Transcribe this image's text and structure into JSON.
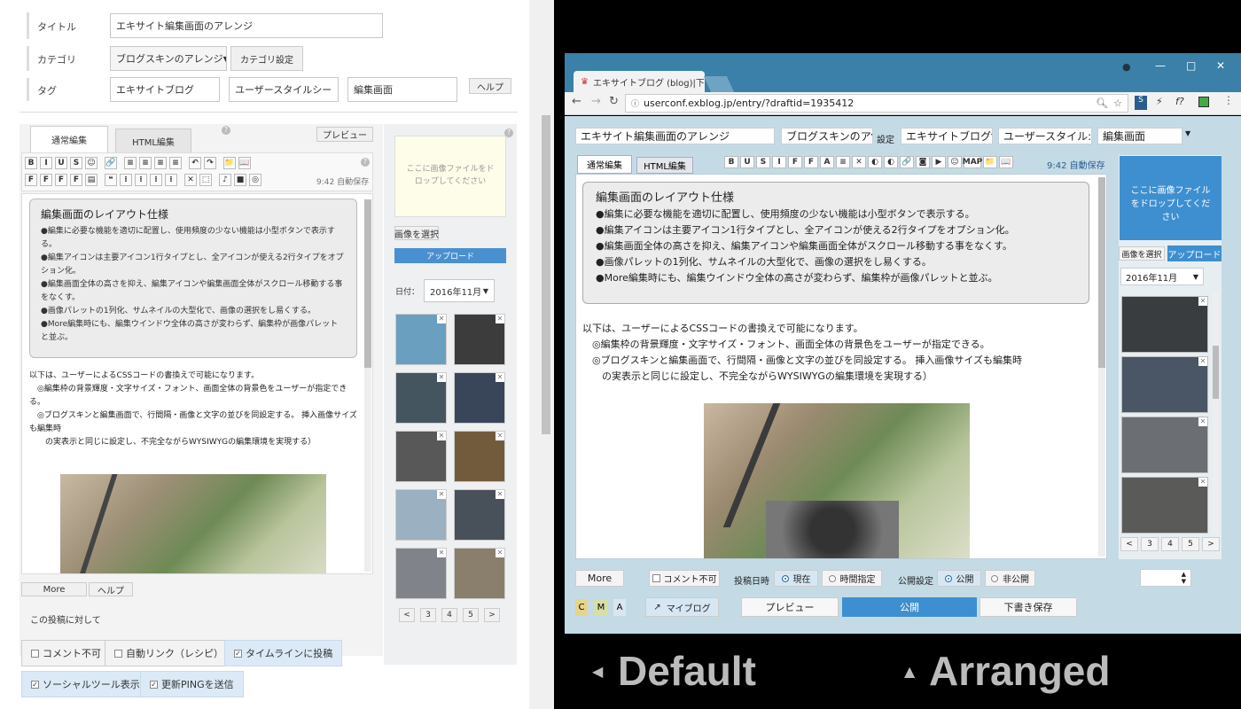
{
  "default_editor": {
    "fields": {
      "title_label": "タイトル",
      "title_value": "エキサイト編集画面のアレンジ",
      "category_label": "カテゴリ",
      "category_value": "ブログスキンのアレンジ",
      "category_settings_button": "カテゴリ設定",
      "tag_label": "タグ",
      "tags": [
        "エキサイトブログ",
        "ユーザースタイルシー",
        "編集画面"
      ],
      "help_button": "ヘルプ"
    },
    "tabs": [
      "通常編集",
      "HTML編集"
    ],
    "preview_button": "プレビュー",
    "toolbar_row1": [
      "B",
      "I",
      "U",
      "S",
      "☺",
      "🔗",
      "≡",
      "≡",
      "≡",
      "≡",
      "↶",
      "↷",
      "📁",
      "📖"
    ],
    "toolbar_row2": [
      "F",
      "F",
      "F",
      "F",
      "▤",
      "❝",
      "⁝",
      "⁝",
      "⁝",
      "⁝",
      "✕",
      "⬚",
      "♪",
      "■",
      "◎"
    ],
    "autosave": "9:42 自動保存",
    "blockquote": {
      "heading": "編集画面のレイアウト仕様",
      "lines": [
        "●編集に必要な機能を適切に配置し、使用頻度の少ない機能は小型ボタンで表示する。",
        "●編集アイコンは主要アイコン1行タイプとし、全アイコンが使える2行タイプをオプション化。",
        "●編集画面全体の高さを抑え、編集アイコンや編集画面全体がスクロール移動する事をなくす。",
        "●画像パレットの1列化、サムネイルの大型化で、画像の選択をし易くする。",
        "●More編集時にも、編集ウインドウ全体の高さが変わらず、編集枠が画像パレットと並ぶ。"
      ]
    },
    "body_lines": [
      "以下は、ユーザーによるCSSコードの書換えで可能になります。",
      "　◎編集枠の背景輝度・文字サイズ・フォント、画面全体の背景色をユーザーが指定できる。",
      "　◎ブログスキンと編集画面で、行間隔・画像と文字の並びを同設定する。 挿入画像サイズも編集時",
      "　　の実表示と同じに設定し、不完全ながらWYSIWYGの編集環境を実現する）"
    ],
    "image_panel": {
      "drop_text": "ここに画像ファイルをドロップしてください",
      "select_button": "画像を選択",
      "upload_button": "アップロード",
      "date_label": "日付：",
      "date_value": "2016年11月",
      "pages": [
        "<",
        "3",
        "4",
        "5",
        ">"
      ]
    },
    "more_button": "More",
    "help_button2": "ヘルプ",
    "post_options_title": "この投稿に対して",
    "checkboxes": [
      {
        "label": "コメント不可",
        "checked": false
      },
      {
        "label": "自動リンク（レシピ）",
        "checked": false
      },
      {
        "label": "タイムラインに投稿",
        "checked": true
      },
      {
        "label": "ソーシャルツール表示",
        "checked": true
      },
      {
        "label": "更新PINGを送信",
        "checked": true
      }
    ]
  },
  "arranged_editor": {
    "browser": {
      "tab_title": "エキサイトブログ (blog)|下書",
      "url": "userconf.exblog.jp/entry/?draftid=1935412"
    },
    "title_value": "エキサイト編集画面のアレンジ",
    "category_value": "ブログスキンのア",
    "settings_label": "設定",
    "tags": [
      "エキサイトブログ",
      "ユーザースタイル:",
      "編集画面"
    ],
    "tabs": [
      "通常編集",
      "HTML編集"
    ],
    "toolbar": [
      "B",
      "U",
      "S",
      "I",
      "F",
      "F",
      "A",
      "≡",
      "✕",
      "◐",
      "◐",
      "🔗",
      "◙",
      "▶",
      "☺",
      "MAP",
      "📁",
      "📖"
    ],
    "autosave": "9:42 自動保存",
    "blockquote": {
      "heading": "編集画面のレイアウト仕様",
      "lines": [
        "●編集に必要な機能を適切に配置し、使用頻度の少ない機能は小型ボタンで表示する。",
        "●編集アイコンは主要アイコン1行タイプとし、全アイコンが使える2行タイプをオプション化。",
        "●編集画面全体の高さを抑え、編集アイコンや編集画面全体がスクロール移動する事をなくす。",
        "●画像パレットの1列化、サムネイルの大型化で、画像の選択をし易くする。",
        "●More編集時にも、編集ウインドウ全体の高さが変わらず、編集枠が画像パレットと並ぶ。"
      ]
    },
    "body_lines": [
      "以下は、ユーザーによるCSSコードの書換えで可能になります。",
      "　◎編集枠の背景輝度・文字サイズ・フォント、画面全体の背景色をユーザーが指定できる。",
      "　◎ブログスキンと編集画面で、行間隔・画像と文字の並びを同設定する。 挿入画像サイズも編集時",
      "　　の実表示と同じに設定し、不完全ながらWYSIWYGの編集環境を実現する）"
    ],
    "image_panel": {
      "drop_text": "ここに画像ファイルをドロップしてください",
      "select_button": "画像を選択",
      "upload_button": "アップロード",
      "date_value": "2016年11月",
      "pages": [
        "<",
        "3",
        "4",
        "5",
        ">"
      ]
    },
    "more_button": "More",
    "comment_disable": "コメント不可",
    "post_time_label": "投稿日時",
    "post_time_options": [
      {
        "label": "現在",
        "selected": true
      },
      {
        "label": "時間指定",
        "selected": false
      }
    ],
    "visibility_label": "公開設定",
    "visibility_options": [
      {
        "label": "公開",
        "selected": true
      },
      {
        "label": "非公開",
        "selected": false
      }
    ],
    "cma_buttons": [
      "C",
      "M",
      "A"
    ],
    "myblog_button": "マイブログ",
    "preview_button": "プレビュー",
    "publish_button": "公開",
    "draft_button": "下書き保存"
  },
  "captions": {
    "default": "Default",
    "arranged": "Arranged"
  },
  "colors": {
    "right_background": "#c4dbe6",
    "chrome_titlebar": "#3a80a8",
    "accent_blue": "#4a90d0"
  }
}
